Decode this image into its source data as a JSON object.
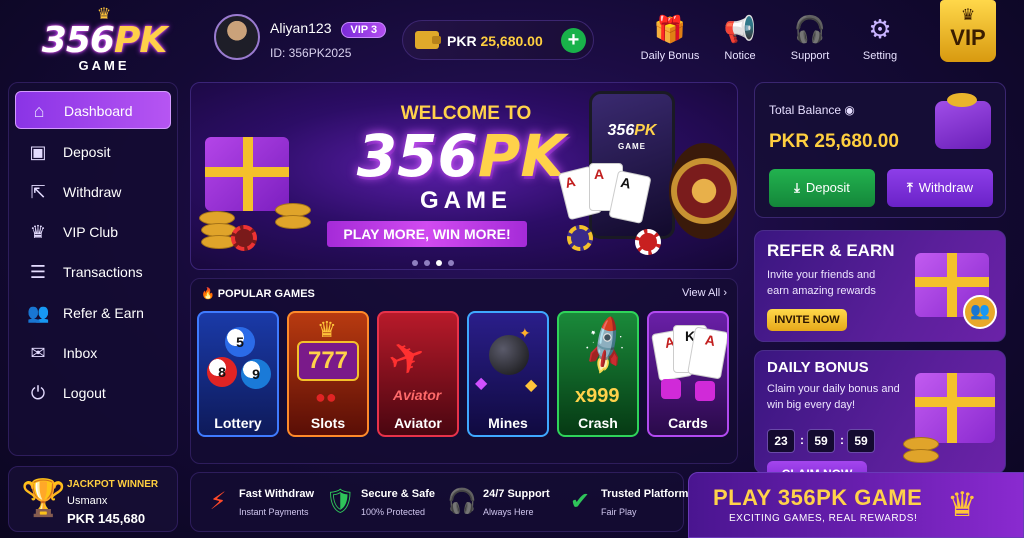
{
  "brand": {
    "logo_main": "356",
    "logo_accent": "PK",
    "logo_sub": "GAME"
  },
  "user": {
    "name": "Aliyan123",
    "vip": "VIP 3",
    "id": "ID: 356PK2025"
  },
  "wallet": {
    "currency": "PKR",
    "amount": "25,680.00"
  },
  "topnav": [
    {
      "label": "Daily Bonus",
      "icon": "gift-icon"
    },
    {
      "label": "Notice",
      "icon": "megaphone-icon"
    },
    {
      "label": "Support",
      "icon": "headset-icon"
    },
    {
      "label": "Setting",
      "icon": "gear-icon"
    }
  ],
  "vip_badge": "VIP",
  "sidebar": {
    "items": [
      {
        "label": "Dashboard",
        "icon": "home-icon",
        "active": true
      },
      {
        "label": "Deposit",
        "icon": "wallet-icon"
      },
      {
        "label": "Withdraw",
        "icon": "withdraw-icon"
      },
      {
        "label": "VIP Club",
        "icon": "crown-icon"
      },
      {
        "label": "Transactions",
        "icon": "receipt-icon"
      },
      {
        "label": "Refer & Earn",
        "icon": "users-icon"
      },
      {
        "label": "Inbox",
        "icon": "mail-icon"
      },
      {
        "label": "Logout",
        "icon": "power-icon"
      }
    ]
  },
  "jackpot": {
    "title": "JACKPOT WINNER",
    "name": "Usmanx",
    "amount": "PKR 145,680"
  },
  "banner": {
    "welcome": "WELCOME TO",
    "title_main": "356",
    "title_accent": "PK",
    "subtitle": "GAME",
    "ribbon": "PLAY MORE, WIN MORE!",
    "phone_logo_main": "356",
    "phone_logo_accent": "PK",
    "phone_logo_sub": "GAME",
    "slides": 4,
    "active_slide": 3
  },
  "games": {
    "title": "POPULAR GAMES",
    "view_all": "View All",
    "tiles": [
      {
        "label": "Lottery",
        "border": "#3f7bff"
      },
      {
        "label": "Slots",
        "border": "#ff8a2a"
      },
      {
        "label": "Aviator",
        "border": "#e8324a",
        "art_text": "Aviator"
      },
      {
        "label": "Mines",
        "border": "#3fa8ff"
      },
      {
        "label": "Crash",
        "border": "#2fd45a",
        "art_text": "x999"
      },
      {
        "label": "Cards",
        "border": "#b24af0"
      }
    ]
  },
  "balance": {
    "label": "Total Balance",
    "amount": "PKR 25,680.00",
    "deposit": "Deposit",
    "withdraw": "Withdraw"
  },
  "refer": {
    "title": "REFER & EARN",
    "desc": "Invite your friends and earn amazing rewards",
    "button": "INVITE NOW"
  },
  "daily": {
    "title": "DAILY BONUS",
    "desc": "Claim your daily bonus and win big every day!",
    "timer": [
      "23",
      "59",
      "59"
    ],
    "button": "CLAIM NOW"
  },
  "features": [
    {
      "title": "Fast Withdraw",
      "sub": "Instant Payments",
      "icon": "lightning-icon",
      "color": "#ff4a2a"
    },
    {
      "title": "Secure & Safe",
      "sub": "100% Protected",
      "icon": "shield-check-icon",
      "color": "#2fc45a"
    },
    {
      "title": "24/7 Support",
      "sub": "Always Here",
      "icon": "headset-icon",
      "color": "#7a6aff"
    },
    {
      "title": "Trusted Platform",
      "sub": "Fair Play",
      "icon": "check-circle-icon",
      "color": "#2fc45a"
    }
  ],
  "play_banner": {
    "title": "PLAY 356PK GAME",
    "subtitle": "EXCITING GAMES, REAL REWARDS!"
  }
}
